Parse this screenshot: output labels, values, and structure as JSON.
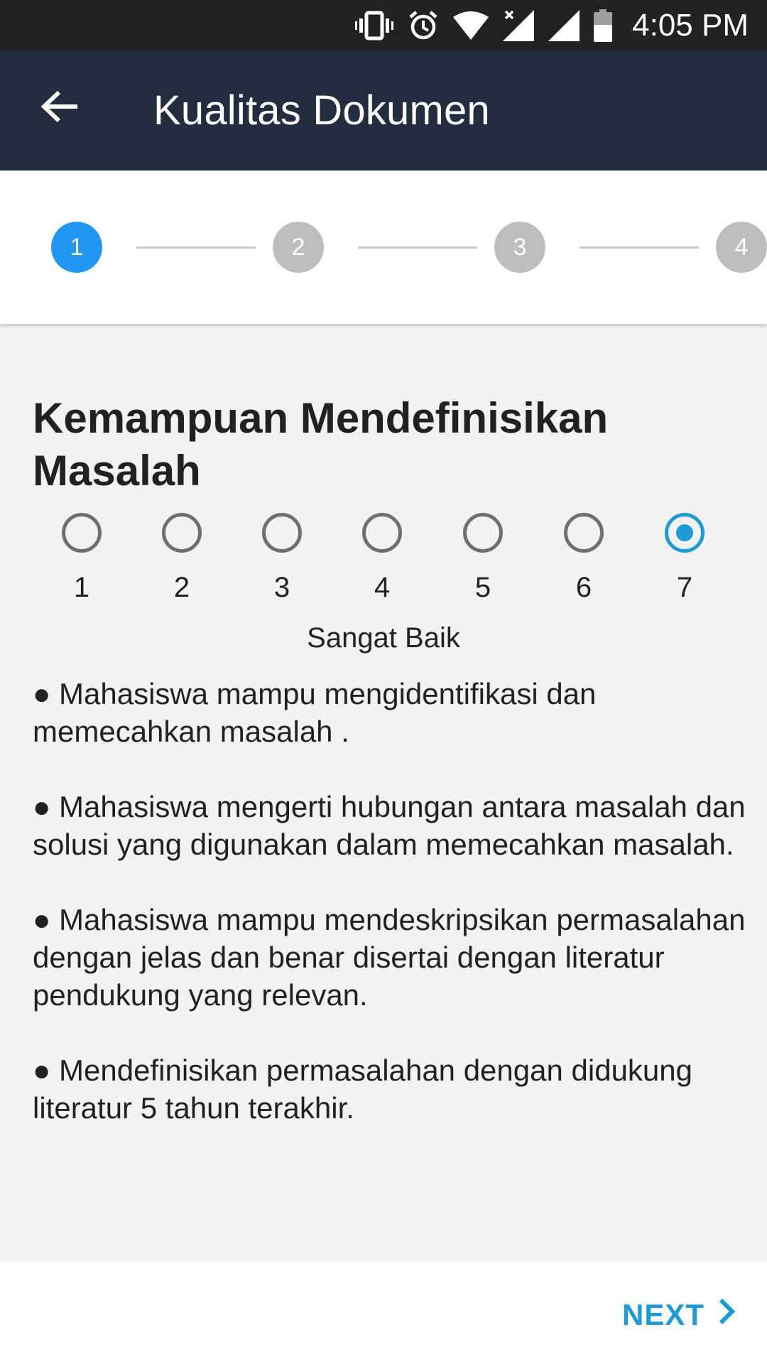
{
  "status_bar": {
    "time": "4:05 PM",
    "icons": [
      "vibrate-icon",
      "alarm-icon",
      "wifi-icon",
      "signal-no-data-icon",
      "signal-icon",
      "battery-icon"
    ]
  },
  "app_bar": {
    "title": "Kualitas Dokumen",
    "back_icon": "arrow-back-icon",
    "background_color": "#232d3f"
  },
  "stepper": {
    "steps": [
      {
        "label": "1",
        "state": "active"
      },
      {
        "label": "2",
        "state": "inactive"
      },
      {
        "label": "3",
        "state": "inactive"
      },
      {
        "label": "4",
        "state": "inactive"
      }
    ],
    "active_color": "#2196f3",
    "inactive_color": "#bdbdbd"
  },
  "question": {
    "title": "Kemampuan Mendefinisikan Masalah",
    "options": [
      "1",
      "2",
      "3",
      "4",
      "5",
      "6",
      "7"
    ],
    "selected": "7",
    "selected_label": "Sangat Baik",
    "accent_color": "#1e9ad6",
    "criteria": [
      "● Mahasiswa mampu mengidentifikasi dan memecahkan masalah .",
      "● Mahasiswa mengerti hubungan antara masalah dan solusi yang digunakan dalam memecahkan masalah.",
      "● Mahasiswa mampu mendeskripsikan permasalahan dengan jelas dan benar disertai dengan literatur pendukung yang relevan.",
      "● Mendefinisikan permasalahan dengan didukung literatur 5 tahun terakhir."
    ]
  },
  "footer": {
    "next_label": "NEXT",
    "next_icon": "chevron-right-icon"
  }
}
